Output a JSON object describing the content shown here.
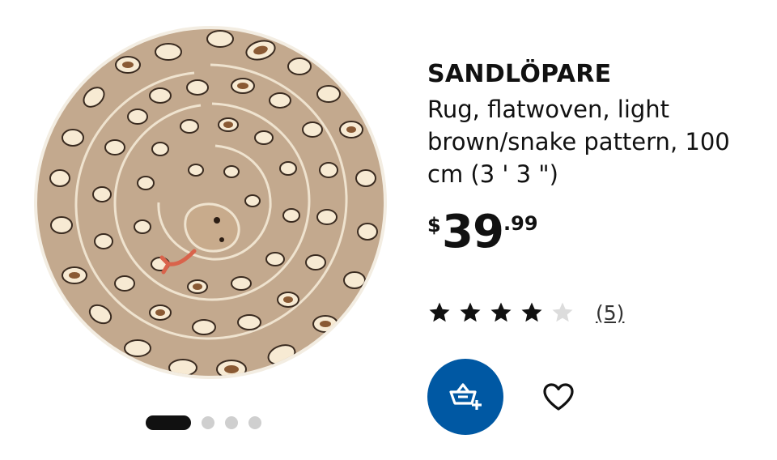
{
  "product": {
    "name": "SANDLÖPARE",
    "description": "Rug, flatwoven, light brown/snake pattern, 100 cm (3 ' 3 \")",
    "price": {
      "currency": "$",
      "integer": "39",
      "decimal": ".99"
    },
    "rating": {
      "stars": 4,
      "max": 5,
      "reviews_label": "(5)"
    }
  },
  "gallery": {
    "image_count": 4,
    "active_index": 0
  },
  "actions": {
    "add_to_cart": "shopping-bag-plus-icon",
    "favourite": "heart-icon"
  },
  "colors": {
    "brand_blue": "#0058a3",
    "star_filled": "#111111",
    "star_empty": "#dcdcdc",
    "rug_base": "#c3a98e"
  }
}
